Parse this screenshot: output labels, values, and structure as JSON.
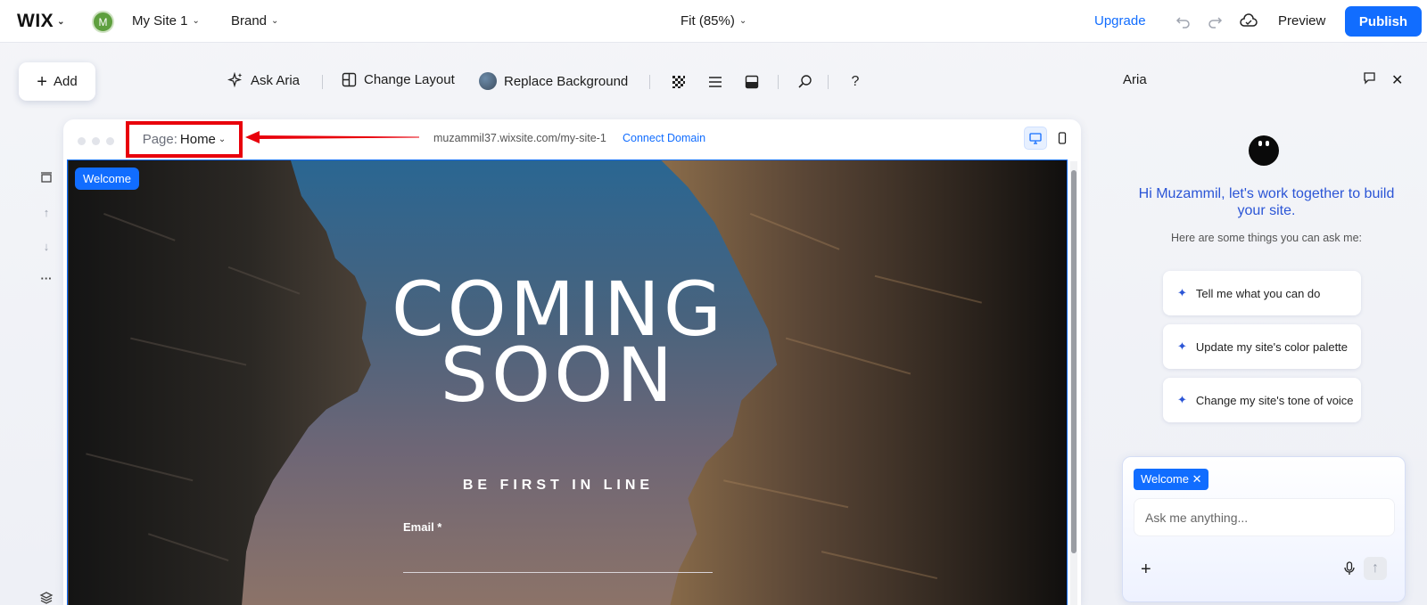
{
  "topbar": {
    "logo": "WIX",
    "avatar_initial": "M",
    "site_name": "My Site 1",
    "brand_label": "Brand",
    "zoom_label": "Fit (85%)",
    "upgrade_label": "Upgrade",
    "preview_label": "Preview",
    "publish_label": "Publish"
  },
  "toolbar": {
    "add_label": "Add",
    "ask_aria_label": "Ask Aria",
    "change_layout_label": "Change Layout",
    "replace_background_label": "Replace Background"
  },
  "frame": {
    "page_prefix": "Page:",
    "page_name": "Home",
    "url": "muzammil37.wixsite.com/my-site-1",
    "connect_domain": "Connect Domain"
  },
  "site": {
    "section_tag": "Welcome",
    "headline_line1": "COMING",
    "headline_line2": "SOON",
    "subheadline": "BE FIRST IN LINE",
    "email_label": "Email *"
  },
  "aria": {
    "title": "Aria",
    "greeting": "Hi Muzammil, let's work together to build your site.",
    "hint": "Here are some things you can ask me:",
    "suggestions": [
      "Tell me what you can do",
      "Update my site's color palette",
      "Change my site's tone of voice"
    ],
    "context_tag": "Welcome",
    "input_placeholder": "Ask me anything..."
  },
  "colors": {
    "accent": "#116dff",
    "highlight_box": "#e8000b",
    "aria_text": "#2b55d6"
  }
}
